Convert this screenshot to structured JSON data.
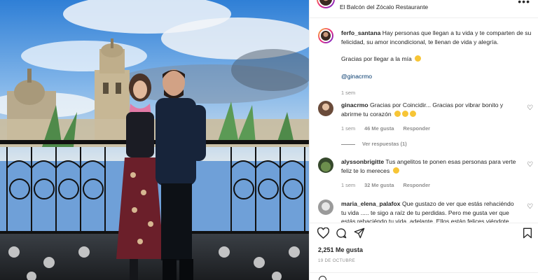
{
  "post_header": {
    "location": "El Balcón del Zócalo Restaurante",
    "more_icon": "more-horizontal-icon"
  },
  "caption": {
    "username": "ferfo_santana",
    "text": "Hay personas que llegan a tu vida y te comparten de su felicidad, su amor incondicional, te llenan de vida y alegría.",
    "thanks": "Gracias por llegar a la mía",
    "mention": "@ginacrmo",
    "time": "1 sem"
  },
  "comments": [
    {
      "username": "ginacrmo",
      "text": "Gracias por Coincidir... Gracias por vibrar bonito y abrirme tu corazón",
      "time": "1 sem",
      "likes": "46 Me gusta",
      "reply_label": "Responder",
      "view_replies": "Ver respuestas (1)"
    },
    {
      "username": "alyssonbrigitte",
      "text": "Tus angelitos te ponen esas personas para verte feliz te lo mereces",
      "time": "1 sem",
      "likes": "32 Me gusta",
      "reply_label": "Responder"
    },
    {
      "username": "maria_elena_palafox",
      "text": "Que gustazo de ver que estás rehaciéndo tu vida ..... te sigo a raíz de tu perdidas. Pero me gusta ver que estás rehaciéndo tu vida, adelante. Ellos están felices viéndote"
    }
  ],
  "actions": {
    "like_icon": "heart-icon",
    "comment_icon": "comment-icon",
    "share_icon": "send-icon",
    "save_icon": "bookmark-icon"
  },
  "likes_count": "2,251 Me gusta",
  "post_date": "19 DE OCTUBRE",
  "colors": {
    "text": "#262626",
    "muted": "#8e8e8e",
    "link": "#00376b",
    "border": "#efefef"
  }
}
